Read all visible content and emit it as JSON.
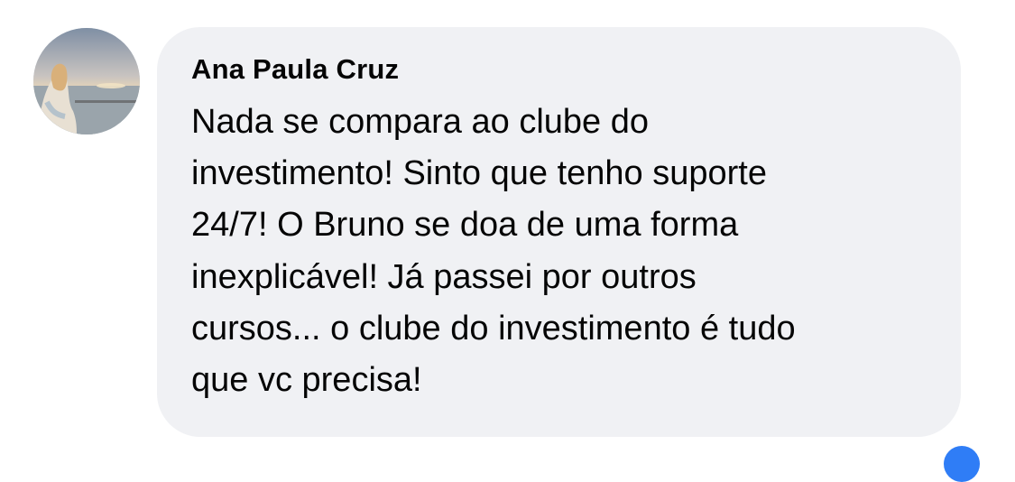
{
  "comment": {
    "author": "Ana Paula Cruz",
    "text": "Nada se compara ao clube do\ninvestimento! Sinto que tenho suporte\n24/7! O Bruno se doa de uma forma\ninexplicável! Já passei por outros\ncursos... o clube do investimento é tudo\nque vc precisa!"
  },
  "colors": {
    "bubble": "#f0f1f4",
    "text": "#050505",
    "reaction_accent": "#2f7df6"
  },
  "icons": {
    "avatar": "profile-photo",
    "reaction": "reaction-icon"
  }
}
